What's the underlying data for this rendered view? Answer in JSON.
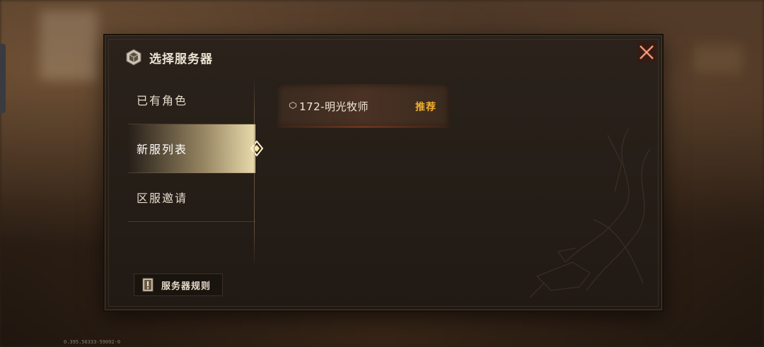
{
  "dialog": {
    "title": "选择服务器",
    "colors": {
      "accent": "#f0b030",
      "text": "#e6dccd",
      "panel": "#221b15"
    }
  },
  "sidebar": {
    "items": [
      {
        "label": "已有角色",
        "active": false
      },
      {
        "label": "新服列表",
        "active": true
      },
      {
        "label": "区服邀请",
        "active": false
      }
    ]
  },
  "servers": [
    {
      "name": "172-明光牧师",
      "badge": "推荐",
      "icon": "server-diamond-icon"
    }
  ],
  "rules_button": {
    "label": "服务器规则",
    "icon": "rulebook-icon"
  },
  "close_button": {
    "icon": "close-icon"
  },
  "version": "0.395.56333-59092-0"
}
